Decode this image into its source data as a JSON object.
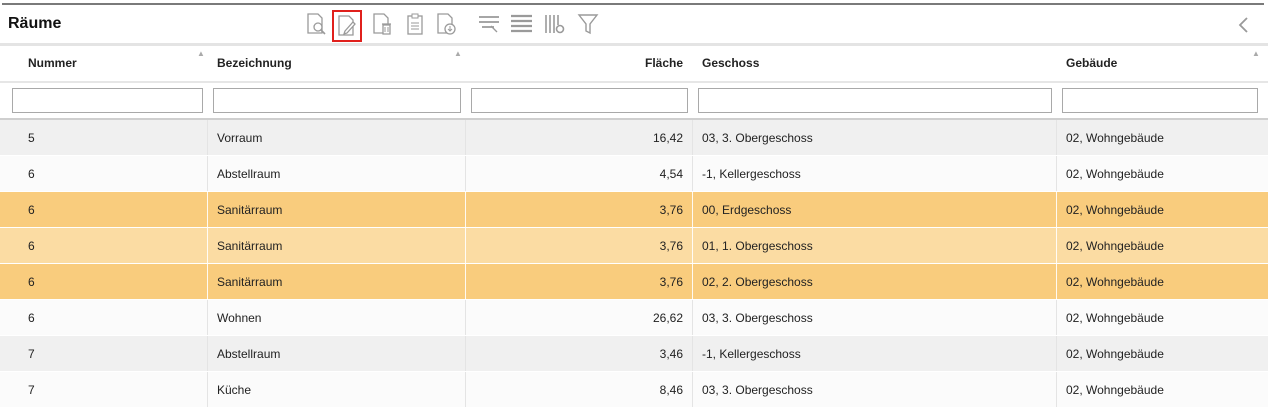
{
  "panel": {
    "title": "Räume"
  },
  "toolbar": {
    "items": [
      {
        "name": "preview-icon"
      },
      {
        "name": "edit-icon",
        "active": true
      },
      {
        "name": "delete-icon"
      },
      {
        "name": "clipboard-icon"
      },
      {
        "name": "export-icon"
      },
      {
        "name": "filter-select-icon"
      },
      {
        "name": "list-icon"
      },
      {
        "name": "column-settings-icon"
      },
      {
        "name": "funnel-icon"
      }
    ],
    "collapse_icon": "chevron-left-icon"
  },
  "table": {
    "columns": [
      {
        "key": "nummer",
        "label": "Nummer",
        "sorted": true
      },
      {
        "key": "bezeichnung",
        "label": "Bezeichnung",
        "sorted": true
      },
      {
        "key": "flaeche",
        "label": "Fläche"
      },
      {
        "key": "geschoss",
        "label": "Geschoss"
      },
      {
        "key": "gebaeude",
        "label": "Gebäude",
        "sorted": true
      }
    ],
    "filters": [
      "",
      "",
      "",
      "",
      ""
    ],
    "rows": [
      {
        "nummer": "5",
        "bezeichnung": "Vorraum",
        "flaeche": "16,42",
        "geschoss": "03, 3. Obergeschoss",
        "gebaeude": "02, Wohngebäude",
        "state": "odd"
      },
      {
        "nummer": "6",
        "bezeichnung": "Abstellraum",
        "flaeche": "4,54",
        "geschoss": "-1, Kellergeschoss",
        "gebaeude": "02, Wohngebäude",
        "state": "even"
      },
      {
        "nummer": "6",
        "bezeichnung": "Sanitärraum",
        "flaeche": "3,76",
        "geschoss": "00, Erdgeschoss",
        "gebaeude": "02, Wohngebäude",
        "state": "sel-dark"
      },
      {
        "nummer": "6",
        "bezeichnung": "Sanitärraum",
        "flaeche": "3,76",
        "geschoss": "01, 1. Obergeschoss",
        "gebaeude": "02, Wohngebäude",
        "state": "sel-light"
      },
      {
        "nummer": "6",
        "bezeichnung": "Sanitärraum",
        "flaeche": "3,76",
        "geschoss": "02, 2. Obergeschoss",
        "gebaeude": "02, Wohngebäude",
        "state": "sel-dark"
      },
      {
        "nummer": "6",
        "bezeichnung": "Wohnen",
        "flaeche": "26,62",
        "geschoss": "03, 3. Obergeschoss",
        "gebaeude": "02, Wohngebäude",
        "state": "even"
      },
      {
        "nummer": "7",
        "bezeichnung": "Abstellraum",
        "flaeche": "3,46",
        "geschoss": "-1, Kellergeschoss",
        "gebaeude": "02, Wohngebäude",
        "state": "odd"
      },
      {
        "nummer": "7",
        "bezeichnung": "Küche",
        "flaeche": "8,46",
        "geschoss": "03, 3. Obergeschoss",
        "gebaeude": "02, Wohngebäude",
        "state": "even"
      }
    ]
  },
  "colors": {
    "selected_row_dark": "#f9cc7d",
    "selected_row_light": "#fbdca3",
    "active_tool_border": "#e0201c"
  }
}
